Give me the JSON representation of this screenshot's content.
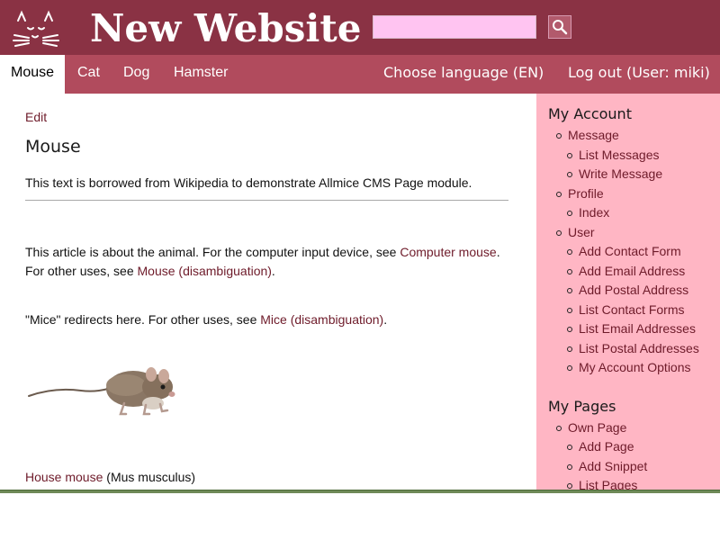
{
  "header": {
    "site_title": "New Website",
    "search_value": "",
    "search_icon": "magnifier-icon",
    "logo_icon": "cat-face-icon"
  },
  "nav": {
    "items": [
      "Mouse",
      "Cat",
      "Dog",
      "Hamster"
    ],
    "language": "Choose language (EN)",
    "logout": "Log out (User: miki)"
  },
  "main": {
    "edit": "Edit",
    "title": "Mouse",
    "intro": "This text is borrowed from Wikipedia to demonstrate Allmice CMS Page module.",
    "about_pre": "This article is about the animal. For the computer input device, see ",
    "about_link1": "Computer mouse",
    "about_mid": ".",
    "about_pre2": "For other uses, see ",
    "about_link2": "Mouse (disambiguation)",
    "about_end": ".",
    "mice_pre": "\"Mice\" redirects here. For other uses, see ",
    "mice_link": "Mice (disambiguation)",
    "mice_end": ".",
    "caption_link": "House mouse",
    "caption_text": " (Mus musculus)"
  },
  "sidebar": {
    "account_heading": "My Account",
    "message": "Message",
    "list_messages": "List Messages",
    "write_message": "Write Message",
    "profile": "Profile",
    "index": "Index",
    "user": "User",
    "add_contact_form": "Add Contact Form",
    "add_email": "Add Email Address",
    "add_postal": "Add Postal Address",
    "list_contact_forms": "List Contact Forms",
    "list_emails": "List Email Addresses",
    "list_postal": "List Postal Addresses",
    "account_options": "My Account Options",
    "pages_heading": "My Pages",
    "own_page": "Own Page",
    "add_page": "Add Page",
    "add_snippet": "Add Snippet",
    "list_pages": "List Pages"
  },
  "colors": {
    "header_bg": "#8a3244",
    "nav_bg": "#b14b5d",
    "sidebar_bg": "#ffb6c4",
    "link": "#6e1b2a",
    "search_bg": "#ffc4f1"
  }
}
